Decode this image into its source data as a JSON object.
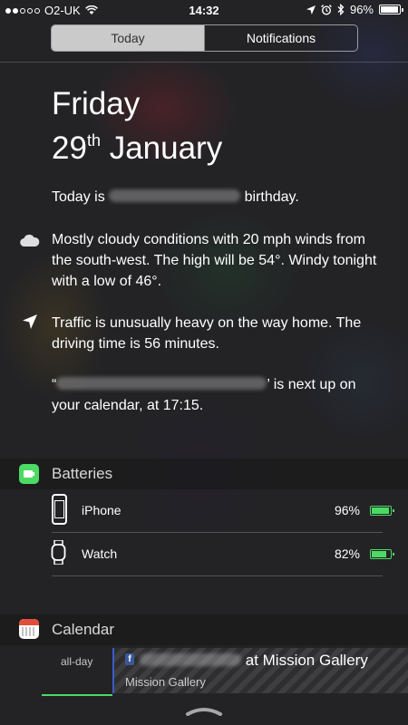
{
  "status_bar": {
    "carrier": "O2-UK",
    "time": "14:32",
    "battery_percent": "96%",
    "battery_level": 0.96,
    "signal_bars_filled": 2,
    "signal_bars_total": 5
  },
  "tabs": [
    {
      "label": "Today",
      "active": true
    },
    {
      "label": "Notifications",
      "active": false
    }
  ],
  "today": {
    "day": "Friday",
    "date_number": "29",
    "date_suffix": "th",
    "month": "January",
    "birthday_prefix": "Today is",
    "birthday_suffix": "birthday.",
    "weather": "Mostly cloudy conditions with 20 mph winds from the south-west. The high will be 54°. Windy tonight with a low of 46°.",
    "traffic": "Traffic is unusually heavy on the way home. The driving time is 56 minutes.",
    "event_prefix": "“",
    "event_suffix": "’ is next up on your calendar, at 17:15."
  },
  "batteries": {
    "title": "Batteries",
    "devices": [
      {
        "name": "iPhone",
        "percent": "96%",
        "level": 0.96,
        "icon": "iphone-icon"
      },
      {
        "name": "Watch",
        "percent": "82%",
        "level": 0.82,
        "icon": "watch-icon"
      }
    ]
  },
  "calendar": {
    "title": "Calendar",
    "allday_label": "all-day",
    "event_title_suffix": "at Mission Gallery",
    "event_location": "Mission Gallery"
  },
  "colors": {
    "battery_green": "#4cd964",
    "calendar_red": "#e24c3a",
    "facebook_blue": "#3b5998"
  }
}
